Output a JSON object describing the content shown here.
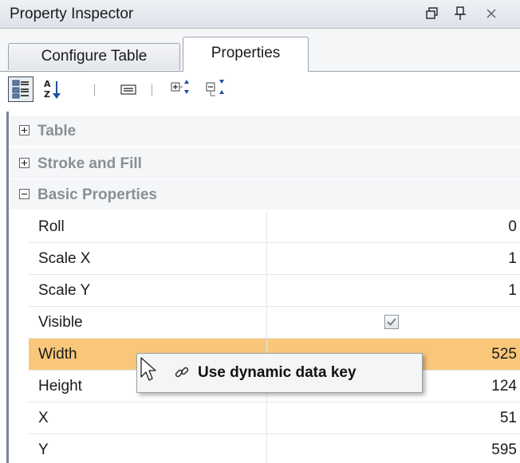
{
  "panel": {
    "title": "Property Inspector"
  },
  "tabs": [
    {
      "label": "Configure Table",
      "active": false
    },
    {
      "label": "Properties",
      "active": true
    }
  ],
  "toolbar": {
    "icons": [
      "categorized-view-icon",
      "sort-alphabetical-icon",
      "property-pages-icon",
      "expand-all-icon",
      "collapse-all-icon"
    ]
  },
  "categories": [
    {
      "label": "Table",
      "expanded": false
    },
    {
      "label": "Stroke and Fill",
      "expanded": false
    },
    {
      "label": "Basic Properties",
      "expanded": true
    }
  ],
  "properties": [
    {
      "name": "Roll",
      "value": "0"
    },
    {
      "name": "Scale X",
      "value": "1"
    },
    {
      "name": "Scale Y",
      "value": "1"
    },
    {
      "name": "Visible",
      "checked": true
    },
    {
      "name": "Width",
      "value": "525",
      "selected": true
    },
    {
      "name": "Height",
      "value": "124"
    },
    {
      "name": "X",
      "value": "51"
    },
    {
      "name": "Y",
      "value": "595"
    }
  ],
  "context_menu": {
    "item_label": "Use dynamic data key",
    "icon": "link-icon"
  },
  "colors": {
    "selected_row": "#f9c77a",
    "category_text": "#8a8f96",
    "title_bar": "#dde2e9"
  }
}
